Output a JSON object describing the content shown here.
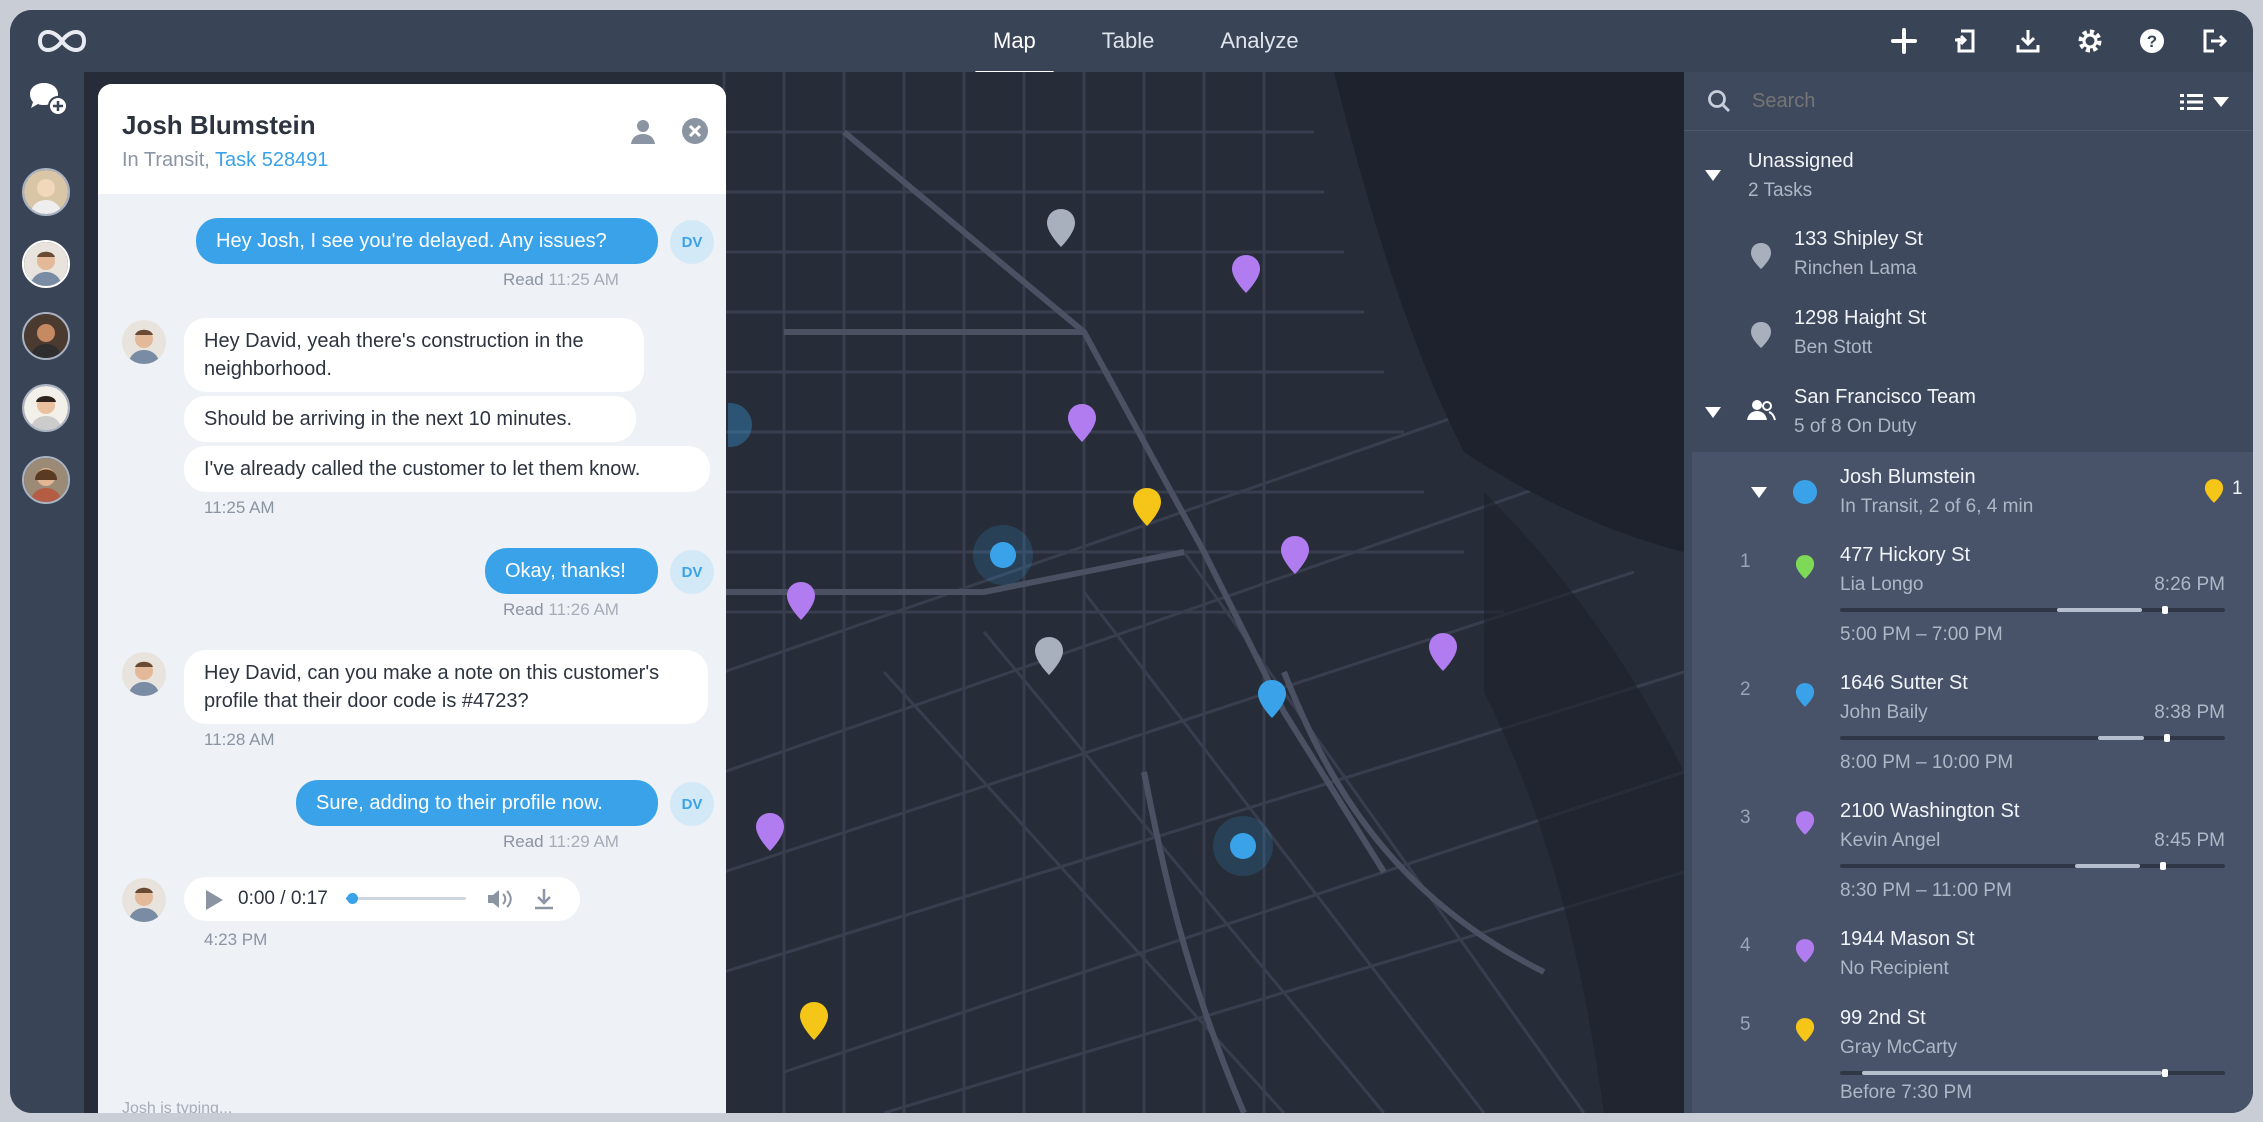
{
  "topbar": {
    "tabs": [
      "Map",
      "Table",
      "Analyze"
    ],
    "active_tab": "Map",
    "icons": [
      "plus-icon",
      "import-icon",
      "download-icon",
      "gear-icon",
      "help-icon",
      "logout-icon"
    ]
  },
  "chat": {
    "name": "Josh Blumstein",
    "status": "In Transit,",
    "task_link": "Task 528491",
    "messages": [
      {
        "dir": "out",
        "text": "Hey Josh, I see you're delayed. Any issues?",
        "read_label": "Read",
        "time": "11:25 AM"
      },
      {
        "dir": "in",
        "text": "Hey David, yeah there's construction in the neighborhood."
      },
      {
        "dir": "in",
        "text": "Should be arriving in the next 10 minutes."
      },
      {
        "dir": "in",
        "text": "I've already called the customer to let them know.",
        "time": "11:25 AM"
      },
      {
        "dir": "out",
        "text": "Okay, thanks!",
        "read_label": "Read",
        "time": "11:26 AM"
      },
      {
        "dir": "in",
        "text": "Hey David, can you make a note on this customer's profile that their door code is #4723?",
        "time": "11:28 AM"
      },
      {
        "dir": "out",
        "text": "Sure, adding to their profile now.",
        "read_label": "Read",
        "time": "11:29 AM"
      }
    ],
    "sender_initials": "DV",
    "audio": {
      "time": "0:00 / 0:17",
      "progress": 0.05,
      "timestamp": "4:23 PM"
    },
    "typing": "Josh is typing..."
  },
  "sidebar": {
    "search_placeholder": "Search",
    "unassigned": {
      "title": "Unassigned",
      "count": "2 Tasks"
    },
    "unassigned_tasks": [
      {
        "address": "133 Shipley St",
        "person": "Rinchen Lama",
        "color": "#a8b0bd"
      },
      {
        "address": "1298 Haight St",
        "person": "Ben Stott",
        "color": "#a8b0bd"
      }
    ],
    "team": {
      "title": "San Francisco Team",
      "duty": "5 of 8 On Duty"
    },
    "driver": {
      "name": "Josh Blumstein",
      "status": "In Transit, 2 of 6, 4 min",
      "badge": "1",
      "color": "#3aa2e8"
    },
    "tasks": [
      {
        "num": "1",
        "address": "477 Hickory St",
        "person": "Lia Longo",
        "eta": "8:26 PM",
        "window": "5:00 PM – 7:00 PM",
        "color": "#7ed957",
        "progress": 0.22
      },
      {
        "num": "2",
        "address": "1646 Sutter St",
        "person": "John Baily",
        "eta": "8:38 PM",
        "window": "8:00 PM – 10:00 PM",
        "color": "#3aa2e8",
        "progress": 0.12
      },
      {
        "num": "3",
        "address": "2100 Washington St",
        "person": "Kevin Angel",
        "eta": "8:45 PM",
        "window": "8:30 PM – 11:00 PM",
        "color": "#b17cf0",
        "progress": 0.17
      },
      {
        "num": "4",
        "address": "1944 Mason St",
        "person": "No Recipient",
        "eta": "",
        "window": "",
        "color": "#b17cf0"
      },
      {
        "num": "5",
        "address": "99 2nd St",
        "person": "Gray McCarty",
        "eta": "",
        "window": "Before 7:30 PM",
        "color": "#f5c518",
        "progress": 0.78
      }
    ]
  },
  "colors": {
    "accent": "#3aa2e8",
    "purple": "#b17cf0",
    "yellow": "#f5c518",
    "gray": "#a8b0bd",
    "green": "#7ed957"
  }
}
